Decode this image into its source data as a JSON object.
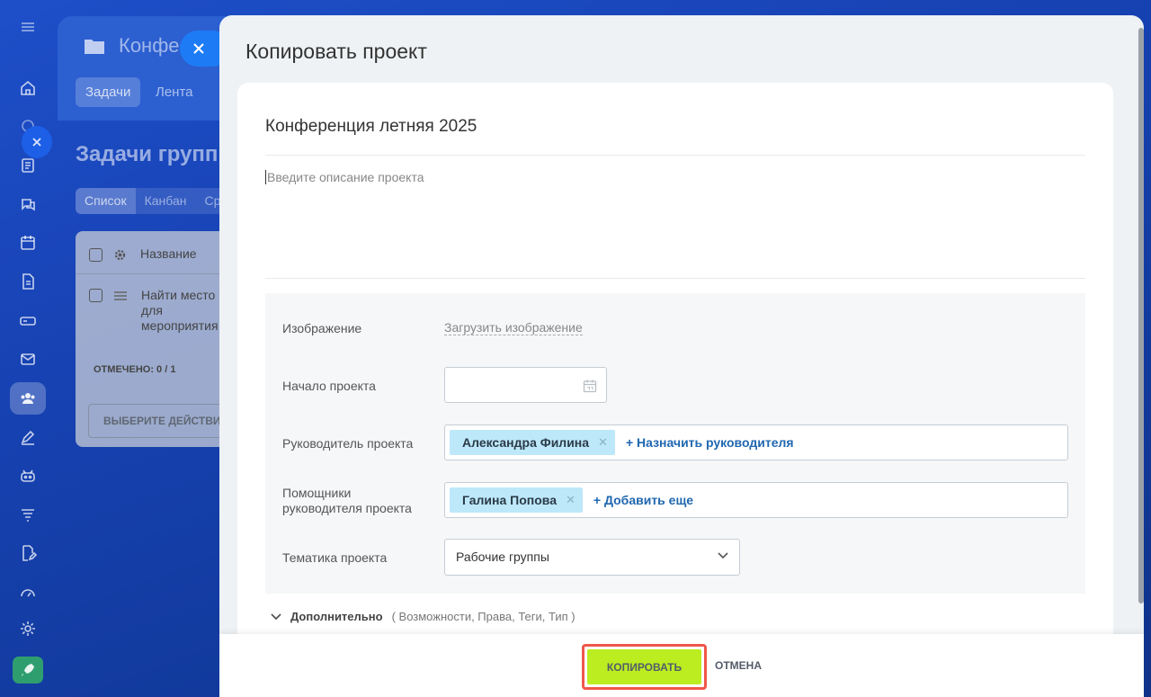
{
  "background": {
    "header_title": "Конфе",
    "tabs": [
      {
        "label": "Задачи"
      },
      {
        "label": "Лента"
      }
    ],
    "page_title": "Задачи групп",
    "views": [
      {
        "label": "Список"
      },
      {
        "label": "Канбан"
      },
      {
        "label": "Ср"
      }
    ],
    "table": {
      "header": "Название",
      "row_text": "Найти место для мероприятия",
      "selected": "ОТМЕЧЕНО: 0 / 1",
      "action": "ВЫБЕРИТЕ ДЕЙСТВИ"
    }
  },
  "panel": {
    "title": "Копировать проект",
    "project_name": "Конференция летняя 2025",
    "description_placeholder": "Введите описание проекта",
    "form": {
      "image_label": "Изображение",
      "upload_link": "Загрузить изображение",
      "start_label": "Начало проекта",
      "start_value": "",
      "owner_label": "Руководитель проекта",
      "owner_name": "Александра Филина",
      "owner_add": "+ Назначить руководителя",
      "helpers_label": "Помощники руководителя проекта",
      "helper_name": "Галина Попова",
      "helpers_add": "+ Добавить еще",
      "subject_label": "Тематика проекта",
      "subject_value": "Рабочие группы"
    },
    "extra_label": "Дополнительно",
    "extra_hint": "( Возможности, Права, Теги, Тип )",
    "footer": {
      "copy_label": "КОПИРОВАТЬ",
      "cancel_label": "ОТМЕНА"
    }
  },
  "colors": {
    "accent_green": "#bbed21",
    "highlight_red": "#f0574a",
    "chip_blue": "#bde8f9",
    "link_blue": "#2067b0"
  }
}
